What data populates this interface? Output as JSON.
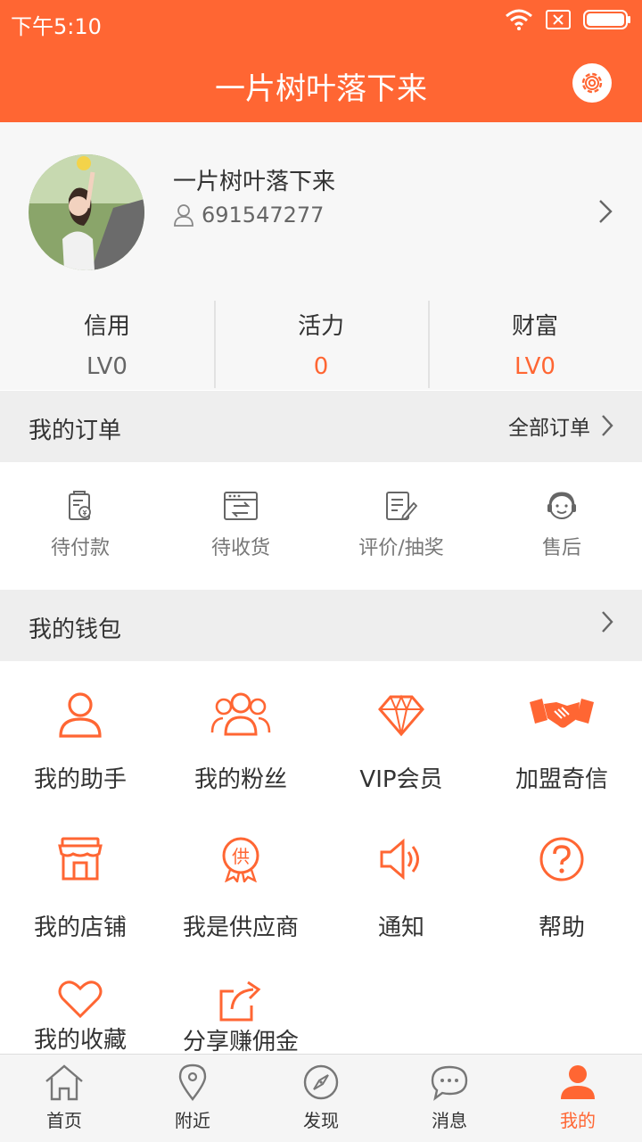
{
  "status_bar": {
    "time": "下午5:10"
  },
  "header": {
    "title": "一片树叶落下来",
    "settings_icon": "gear-icon"
  },
  "profile": {
    "name": "一片树叶落下来",
    "user_id": "691547277"
  },
  "stats": [
    {
      "label": "信用",
      "value": "LV0",
      "color": "#666666"
    },
    {
      "label": "活力",
      "value": "0",
      "color": "#ff6633"
    },
    {
      "label": "财富",
      "value": "LV0",
      "color": "#ff6633"
    }
  ],
  "orders": {
    "title": "我的订单",
    "all_label": "全部订单",
    "items": [
      {
        "label": "待付款",
        "icon": "payment-icon"
      },
      {
        "label": "待收货",
        "icon": "receive-icon"
      },
      {
        "label": "评价/抽奖",
        "icon": "review-icon"
      },
      {
        "label": "售后",
        "icon": "service-icon"
      }
    ]
  },
  "wallet": {
    "title": "我的钱包"
  },
  "features": [
    {
      "label": "我的助手",
      "icon": "person-icon"
    },
    {
      "label": "我的粉丝",
      "icon": "fans-icon"
    },
    {
      "label": "VIP会员",
      "icon": "diamond-icon"
    },
    {
      "label": "加盟奇信",
      "icon": "handshake-icon"
    },
    {
      "label": "我的店铺",
      "icon": "store-icon"
    },
    {
      "label": "我是供应商",
      "icon": "supplier-badge-icon"
    },
    {
      "label": "通知",
      "icon": "speaker-icon"
    },
    {
      "label": "帮助",
      "icon": "help-icon"
    },
    {
      "label": "我的收藏",
      "icon": "heart-icon"
    },
    {
      "label": "分享赚佣金",
      "icon": "share-icon"
    }
  ],
  "tabbar": [
    {
      "label": "首页",
      "icon": "home-icon"
    },
    {
      "label": "附近",
      "icon": "location-icon"
    },
    {
      "label": "发现",
      "icon": "compass-icon"
    },
    {
      "label": "消息",
      "icon": "message-icon"
    },
    {
      "label": "我的",
      "icon": "profile-icon",
      "active": true
    }
  ],
  "colors": {
    "accent": "#ff6633",
    "section_bg": "#eeeeee"
  }
}
